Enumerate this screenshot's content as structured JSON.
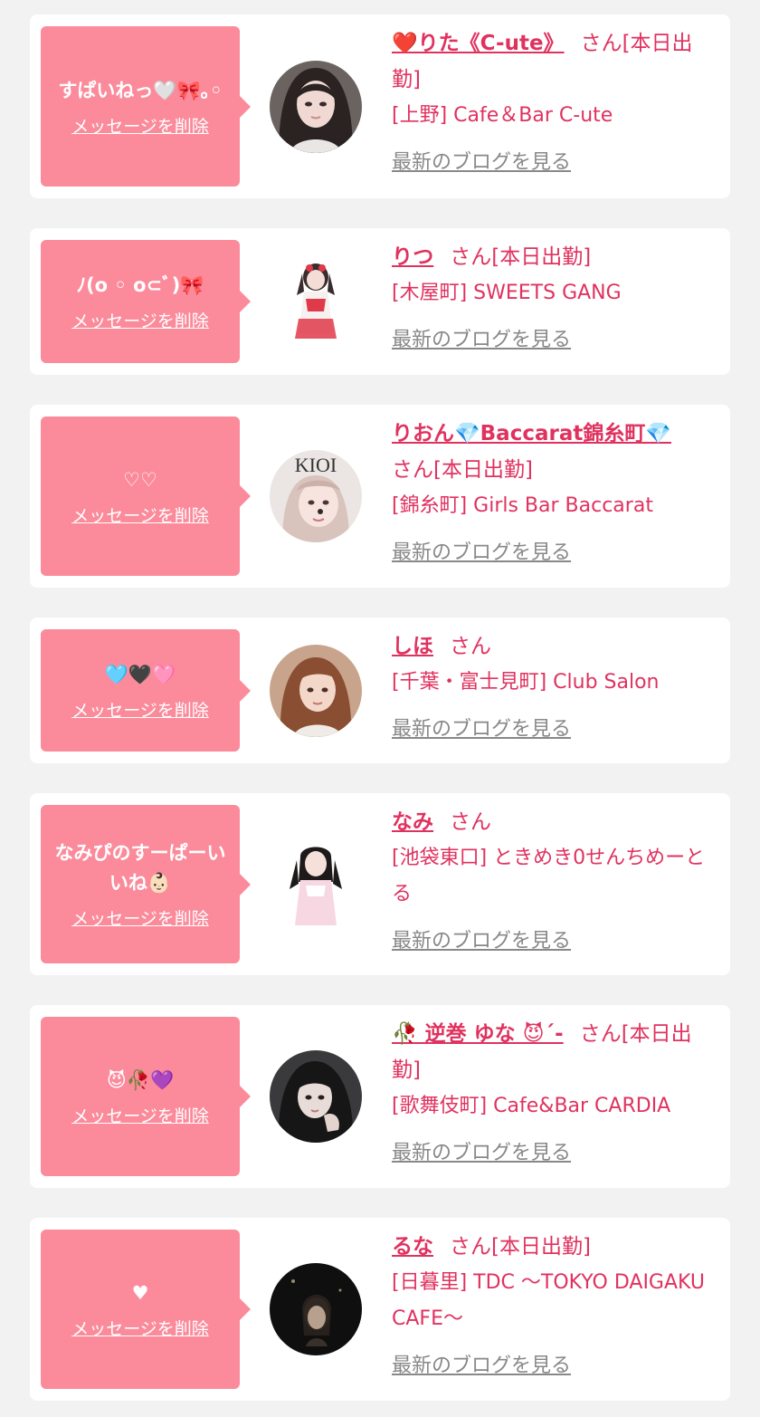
{
  "delete_label": "メッセージを削除",
  "blog_label": "最新のブログを見る",
  "colors": {
    "bubble": "#fb8b9b",
    "accent": "#e0325f",
    "link_gray": "#888888",
    "background": "#f2f2f2"
  },
  "cards": [
    {
      "message": "すぱいねっ🤍🎀｡◦",
      "name": "❤️りた《C-ute》",
      "suffix": "さん[本日出勤]",
      "shop": "[上野] Cafe＆Bar C-ute",
      "avatar": "avatar-photo-rita"
    },
    {
      "message": "ﾉ(o ◦ o⊂ﾞ)🎀",
      "name": "りつ",
      "suffix": "さん[本日出勤]",
      "shop": "[木屋町] SWEETS GANG",
      "avatar": "avatar-photo-ritsu"
    },
    {
      "message": "♡♡",
      "name": "りおん💎Baccarat錦糸町💎",
      "suffix": "さん[本日出勤]",
      "shop": "[錦糸町] Girls Bar Baccarat",
      "avatar": "avatar-photo-rion",
      "avatar_text": "KIOI"
    },
    {
      "message": "🩵🖤🩷",
      "name": "しほ",
      "suffix": "さん",
      "shop": "[千葉・富士見町] Club Salon",
      "avatar": "avatar-photo-shiho"
    },
    {
      "message": "なみぴのすーぱーいいね👶🏻",
      "name": "なみ",
      "suffix": "さん",
      "shop": "[池袋東口] ときめき0せんちめーとる",
      "avatar": "avatar-photo-nami"
    },
    {
      "message": "😈🥀💜",
      "name": "🥀 逆巻 ゆな 😈´-",
      "suffix": "さん[本日出勤]",
      "shop": "[歌舞伎町] Cafe&Bar CARDIA",
      "avatar": "avatar-photo-yuna"
    },
    {
      "message": "♥",
      "name": "るな",
      "suffix": "さん[本日出勤]",
      "shop": "[日暮里] TDC 〜TOKYO DAIGAKU CAFE〜",
      "avatar": "avatar-photo-runa"
    }
  ]
}
